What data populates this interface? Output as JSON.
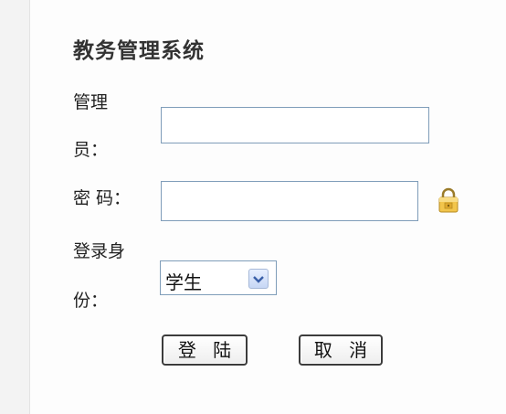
{
  "form": {
    "title": "教务管理系统",
    "username_label_line1": "管理",
    "username_label_line2": "员：",
    "username_value": "",
    "password_label": "密 码：",
    "password_value": "",
    "role_label_line1": "登录身",
    "role_label_line2": "份：",
    "role_selected": "学生",
    "login_button": "登 陆",
    "cancel_button": "取 消"
  },
  "icons": {
    "password_hint": "lock-icon",
    "select_arrow": "chevron-down-icon"
  },
  "colors": {
    "input_border": "#7f9db9",
    "lock_body": "#f0c24a",
    "arrow_button": "#c7d7f5"
  }
}
